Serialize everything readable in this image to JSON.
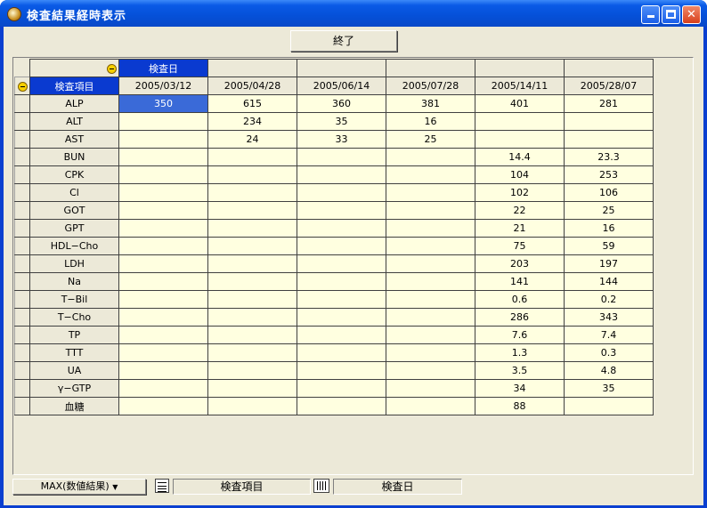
{
  "window": {
    "title": "検査結果経時表示"
  },
  "toolbar": {
    "close_label": "終了"
  },
  "grid": {
    "date_header": "検査日",
    "item_header": "検査項目",
    "dates": [
      "2005/03/12",
      "2005/04/28",
      "2005/06/14",
      "2005/07/28",
      "2005/14/11",
      "2005/28/07"
    ],
    "rows": [
      {
        "name": "ALP",
        "values": [
          "350",
          "615",
          "360",
          "381",
          "401",
          "281"
        ]
      },
      {
        "name": "ALT",
        "values": [
          "",
          "234",
          "35",
          "16",
          "",
          ""
        ]
      },
      {
        "name": "AST",
        "values": [
          "",
          "24",
          "33",
          "25",
          "",
          ""
        ]
      },
      {
        "name": "BUN",
        "values": [
          "",
          "",
          "",
          "",
          "14.4",
          "23.3"
        ]
      },
      {
        "name": "CPK",
        "values": [
          "",
          "",
          "",
          "",
          "104",
          "253"
        ]
      },
      {
        "name": "Cl",
        "values": [
          "",
          "",
          "",
          "",
          "102",
          "106"
        ]
      },
      {
        "name": "GOT",
        "values": [
          "",
          "",
          "",
          "",
          "22",
          "25"
        ]
      },
      {
        "name": "GPT",
        "values": [
          "",
          "",
          "",
          "",
          "21",
          "16"
        ]
      },
      {
        "name": "HDL−Cho",
        "values": [
          "",
          "",
          "",
          "",
          "75",
          "59"
        ]
      },
      {
        "name": "LDH",
        "values": [
          "",
          "",
          "",
          "",
          "203",
          "197"
        ]
      },
      {
        "name": "Na",
        "values": [
          "",
          "",
          "",
          "",
          "141",
          "144"
        ]
      },
      {
        "name": "T−Bil",
        "values": [
          "",
          "",
          "",
          "",
          "0.6",
          "0.2"
        ]
      },
      {
        "name": "T−Cho",
        "values": [
          "",
          "",
          "",
          "",
          "286",
          "343"
        ]
      },
      {
        "name": "TP",
        "values": [
          "",
          "",
          "",
          "",
          "7.6",
          "7.4"
        ]
      },
      {
        "name": "TTT",
        "values": [
          "",
          "",
          "",
          "",
          "1.3",
          "0.3"
        ]
      },
      {
        "name": "UA",
        "values": [
          "",
          "",
          "",
          "",
          "3.5",
          "4.8"
        ]
      },
      {
        "name": "γ−GTP",
        "values": [
          "",
          "",
          "",
          "",
          "34",
          "35"
        ]
      },
      {
        "name": "血糖",
        "values": [
          "",
          "",
          "",
          "",
          "88",
          ""
        ]
      }
    ]
  },
  "statusbar": {
    "aggregate_label": "MAX(数値結果)",
    "row_field": "検査項目",
    "col_field": "検査日"
  }
}
